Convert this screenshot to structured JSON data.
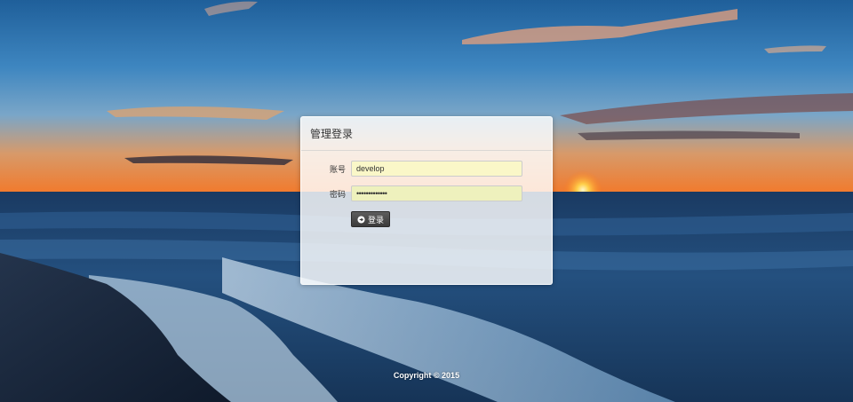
{
  "panel": {
    "title": "管理登录"
  },
  "form": {
    "account_label": "账号",
    "account_value": "develop",
    "password_label": "密码",
    "password_value": "•••••••••••••",
    "submit_label": "登录"
  },
  "footer": {
    "copyright": "Copyright © 2015"
  },
  "colors": {
    "panel_bg": "#ffffff",
    "input_bg": "#faf7c8",
    "button_bg": "#444444"
  },
  "icons": {
    "submit": "arrow-right-circle-icon"
  }
}
